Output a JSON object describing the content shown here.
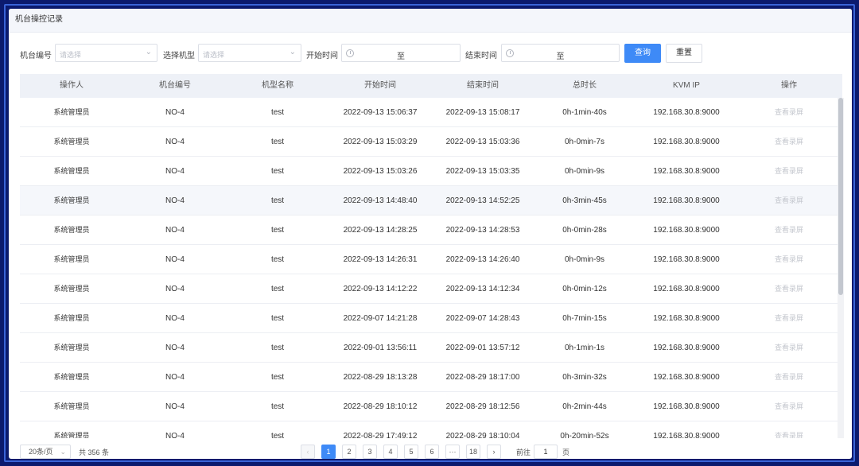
{
  "page": {
    "title": "机台操控记录"
  },
  "filters": {
    "machine_no_label": "机台编号",
    "machine_no_placeholder": "请选择",
    "model_label": "选择机型",
    "model_placeholder": "请选择",
    "start_time_label": "开始时间",
    "end_time_label": "结束时间",
    "range_separator": "至",
    "query_button": "查询",
    "reset_button": "重置"
  },
  "table": {
    "columns": [
      "操作人",
      "机台编号",
      "机型名称",
      "开始时间",
      "结束时间",
      "总时长",
      "KVM IP",
      "操作"
    ],
    "rows": [
      {
        "operator": "系统管理员",
        "machine": "NO-4",
        "model": "test",
        "start": "2022-09-13 15:06:37",
        "end": "2022-09-13 15:08:17",
        "duration": "0h-1min-40s",
        "ip": "192.168.30.8:9000",
        "action": "查看录屏"
      },
      {
        "operator": "系统管理员",
        "machine": "NO-4",
        "model": "test",
        "start": "2022-09-13 15:03:29",
        "end": "2022-09-13 15:03:36",
        "duration": "0h-0min-7s",
        "ip": "192.168.30.8:9000",
        "action": "查看录屏"
      },
      {
        "operator": "系统管理员",
        "machine": "NO-4",
        "model": "test",
        "start": "2022-09-13 15:03:26",
        "end": "2022-09-13 15:03:35",
        "duration": "0h-0min-9s",
        "ip": "192.168.30.8:9000",
        "action": "查看录屏"
      },
      {
        "operator": "系统管理员",
        "machine": "NO-4",
        "model": "test",
        "start": "2022-09-13 14:48:40",
        "end": "2022-09-13 14:52:25",
        "duration": "0h-3min-45s",
        "ip": "192.168.30.8:9000",
        "action": "查看录屏"
      },
      {
        "operator": "系统管理员",
        "machine": "NO-4",
        "model": "test",
        "start": "2022-09-13 14:28:25",
        "end": "2022-09-13 14:28:53",
        "duration": "0h-0min-28s",
        "ip": "192.168.30.8:9000",
        "action": "查看录屏"
      },
      {
        "operator": "系统管理员",
        "machine": "NO-4",
        "model": "test",
        "start": "2022-09-13 14:26:31",
        "end": "2022-09-13 14:26:40",
        "duration": "0h-0min-9s",
        "ip": "192.168.30.8:9000",
        "action": "查看录屏"
      },
      {
        "operator": "系统管理员",
        "machine": "NO-4",
        "model": "test",
        "start": "2022-09-13 14:12:22",
        "end": "2022-09-13 14:12:34",
        "duration": "0h-0min-12s",
        "ip": "192.168.30.8:9000",
        "action": "查看录屏"
      },
      {
        "operator": "系统管理员",
        "machine": "NO-4",
        "model": "test",
        "start": "2022-09-07 14:21:28",
        "end": "2022-09-07 14:28:43",
        "duration": "0h-7min-15s",
        "ip": "192.168.30.8:9000",
        "action": "查看录屏"
      },
      {
        "operator": "系统管理员",
        "machine": "NO-4",
        "model": "test",
        "start": "2022-09-01 13:56:11",
        "end": "2022-09-01 13:57:12",
        "duration": "0h-1min-1s",
        "ip": "192.168.30.8:9000",
        "action": "查看录屏"
      },
      {
        "operator": "系统管理员",
        "machine": "NO-4",
        "model": "test",
        "start": "2022-08-29 18:13:28",
        "end": "2022-08-29 18:17:00",
        "duration": "0h-3min-32s",
        "ip": "192.168.30.8:9000",
        "action": "查看录屏"
      },
      {
        "operator": "系统管理员",
        "machine": "NO-4",
        "model": "test",
        "start": "2022-08-29 18:10:12",
        "end": "2022-08-29 18:12:56",
        "duration": "0h-2min-44s",
        "ip": "192.168.30.8:9000",
        "action": "查看录屏"
      },
      {
        "operator": "系统管理员",
        "machine": "NO-4",
        "model": "test",
        "start": "2022-08-29 17:49:12",
        "end": "2022-08-29 18:10:04",
        "duration": "0h-20min-52s",
        "ip": "192.168.30.8:9000",
        "action": "查看录屏"
      }
    ],
    "highlighted_row": 3
  },
  "pagination": {
    "page_size": "20条/页",
    "total": "共 356 条",
    "prev": "‹",
    "next": "›",
    "pages": [
      "1",
      "2",
      "3",
      "4",
      "5",
      "6",
      "···",
      "18"
    ],
    "current": "1",
    "goto_label": "前往",
    "goto_value": "1",
    "goto_suffix": "页"
  },
  "colors": {
    "background": "#0b1a6e",
    "primary": "#3e8af7",
    "header_bg": "#eef1f7"
  }
}
